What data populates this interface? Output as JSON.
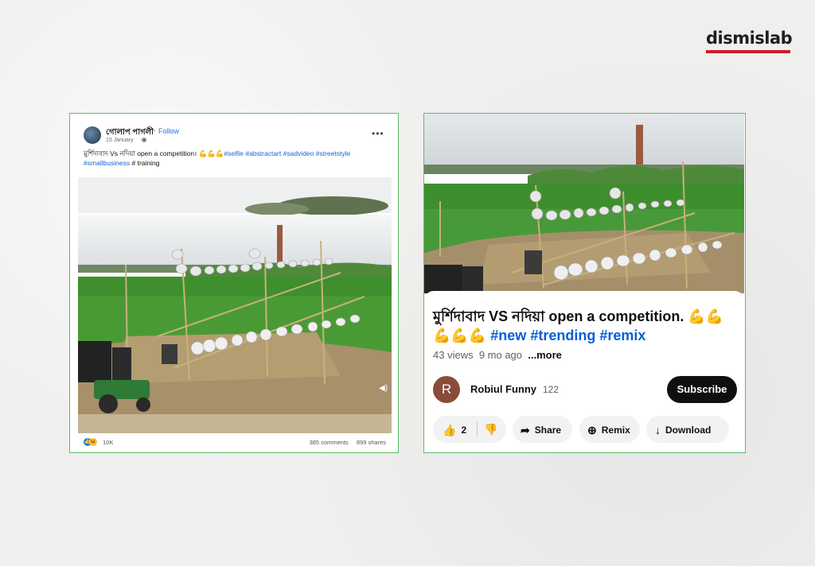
{
  "brand": {
    "name": "dismislab",
    "accent": "#d01c2a"
  },
  "facebook_post": {
    "author": "গোলাপ পাগলী",
    "follow": "Follow",
    "date": "15 January",
    "privacy_icon": "globe-icon",
    "caption_text": "মুর্শিদাবাদ Vs নদিয়া open a competition। ",
    "emoji": "💪💪💪",
    "hashtags": [
      "#selfie",
      "#abstractart",
      "#sadvideo",
      "#streetstyle",
      "#smallbusiness"
    ],
    "caption_tail": "# training",
    "reaction_count": "10K",
    "comments": "385 comments",
    "shares": "899 shares"
  },
  "youtube_short": {
    "title_text": "মুর্শিদাবাদ VS নদিয়া open a competition. ",
    "emoji": "💪💪💪💪💪",
    "hashtags": [
      "#new",
      "#trending",
      "#remix"
    ],
    "views": "43 views",
    "age": "9 mo ago",
    "more": "...more",
    "channel_initial": "R",
    "channel_name": "Robiul Funny",
    "subscriber_count": "122",
    "subscribe_label": "Subscribe",
    "like_count": "2",
    "share_label": "Share",
    "remix_label": "Remix",
    "download_label": "Download"
  },
  "colors": {
    "frame_border": "#5bbd62",
    "fb_link": "#1877f2",
    "yt_link": "#065fd4"
  }
}
